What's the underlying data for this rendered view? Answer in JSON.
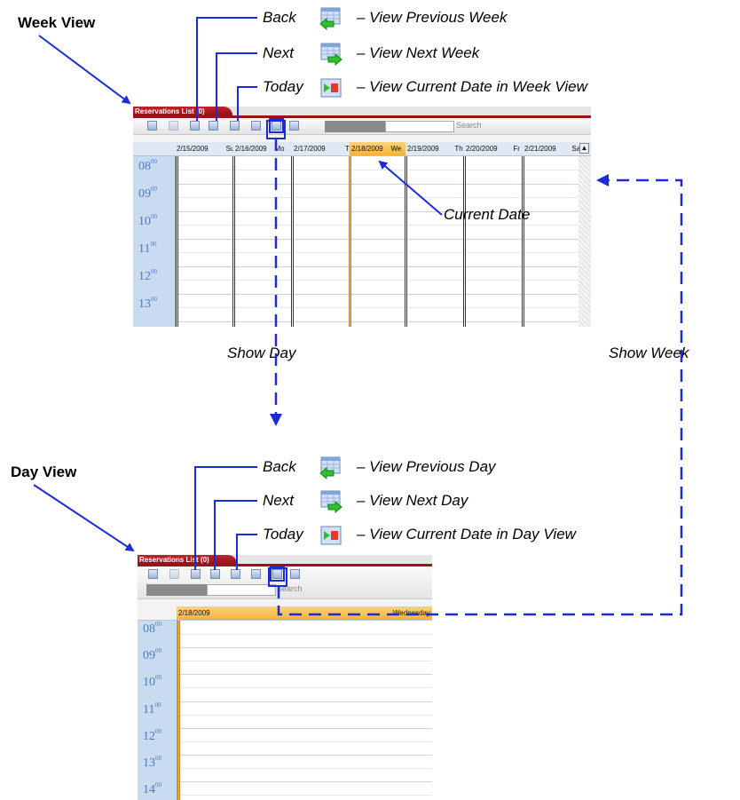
{
  "week": {
    "section_label": "Week View",
    "callouts": [
      {
        "label": "Back",
        "desc": "– View Previous Week"
      },
      {
        "label": "Next",
        "desc": "– View Next Week"
      },
      {
        "label": "Today",
        "desc": "– View Current Date in Week View"
      }
    ],
    "tab_title": "Reservations List (0)",
    "search_label": "Search",
    "days": [
      {
        "date": "2/15/2009",
        "day": "Su"
      },
      {
        "date": "2/16/2009",
        "day": "Mo"
      },
      {
        "date": "2/17/2009",
        "day": "Tu"
      },
      {
        "date": "2/18/2009",
        "day": "We"
      },
      {
        "date": "2/19/2009",
        "day": "Th"
      },
      {
        "date": "2/20/2009",
        "day": "Fr"
      },
      {
        "date": "2/21/2009",
        "day": "Sa"
      }
    ],
    "times": [
      "08",
      "09",
      "10",
      "11",
      "12",
      "13"
    ],
    "current_date_label": "Current Date"
  },
  "annotations": {
    "show_day": "Show Day",
    "show_week": "Show Week"
  },
  "day": {
    "section_label": "Day View",
    "callouts": [
      {
        "label": "Back",
        "desc": "– View Previous Day"
      },
      {
        "label": "Next",
        "desc": "– View Next Day"
      },
      {
        "label": "Today",
        "desc": "– View Current Date in Day View"
      }
    ],
    "tab_title": "Reservations List (0)",
    "search_label": "Search",
    "date": "2/18/2009",
    "weekday": "Wednesday",
    "times": [
      "08",
      "09",
      "10",
      "11",
      "12",
      "13",
      "14"
    ]
  },
  "minutes": "00",
  "colors": {
    "accent": "#1a2bd8",
    "today": "#f3b23c",
    "tab": "#a0151c",
    "time": "#4b7cc1"
  }
}
